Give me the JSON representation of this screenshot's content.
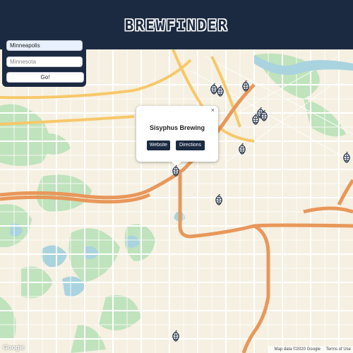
{
  "header": {
    "logo_text": "BREWFINDER"
  },
  "search": {
    "city_value": "Minneapolis",
    "state_placeholder": "Minnesota",
    "go_label": "Go!"
  },
  "popup": {
    "title": "Sisyphus Brewing",
    "close_label": "×",
    "website_label": "Website",
    "directions_label": "Directions"
  },
  "map": {
    "google_logo": "Google",
    "map_data": "Map data ©2020 Google",
    "terms": "Terms of Use",
    "marker_icon": "hop-icon",
    "colors": {
      "header": "#1b2a41",
      "land": "#f5f0e1",
      "highway": "#e8975a",
      "park": "#b7dfb4",
      "water": "#a9d3df"
    }
  }
}
